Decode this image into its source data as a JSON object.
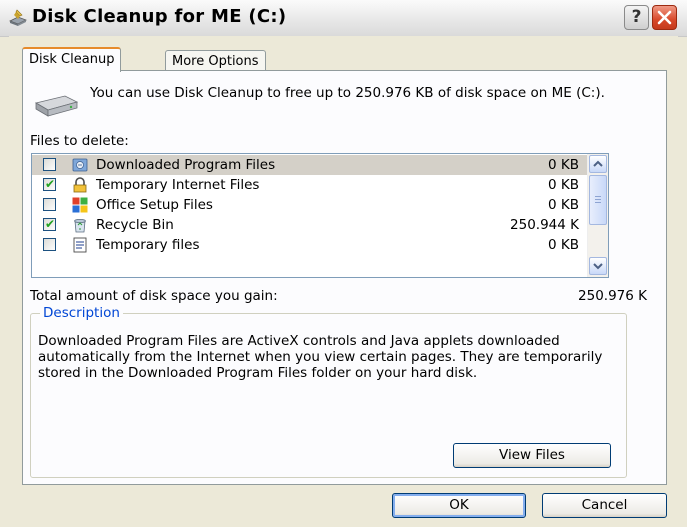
{
  "window": {
    "title": "Disk Cleanup for ME (C:)",
    "help_label": "?"
  },
  "tabs": [
    {
      "label": "Disk Cleanup",
      "active": true
    },
    {
      "label": "More Options",
      "active": false
    }
  ],
  "intro_text": "You can use Disk Cleanup to free up to 250.976 KB of disk space on ME (C:).",
  "files_label": "Files to delete:",
  "files": [
    {
      "name": "Downloaded Program Files",
      "size": "0 KB",
      "checked": false,
      "selected": true,
      "icon": "downloaded-files-icon"
    },
    {
      "name": "Temporary Internet Files",
      "size": "0 KB",
      "checked": true,
      "selected": false,
      "icon": "lock-icon"
    },
    {
      "name": "Office Setup Files",
      "size": "0 KB",
      "checked": false,
      "selected": false,
      "icon": "office-icon"
    },
    {
      "name": "Recycle Bin",
      "size": "250.944 K",
      "checked": true,
      "selected": false,
      "icon": "recycle-bin-icon"
    },
    {
      "name": "Temporary files",
      "size": "0 KB",
      "checked": false,
      "selected": false,
      "icon": "temp-files-icon"
    }
  ],
  "total_label": "Total amount of disk space you gain:",
  "total_value": "250.976 K",
  "description": {
    "legend": "Description",
    "text": "Downloaded Program Files are ActiveX controls and Java applets downloaded automatically from the Internet when you view certain pages. They are temporarily stored in the Downloaded Program Files folder on your hard disk."
  },
  "buttons": {
    "view_files": "View Files",
    "ok": "OK",
    "cancel": "Cancel"
  },
  "colors": {
    "accent_tab": "#e68b2c",
    "legend_blue": "#0046d5",
    "close_red": "#d8492a"
  }
}
